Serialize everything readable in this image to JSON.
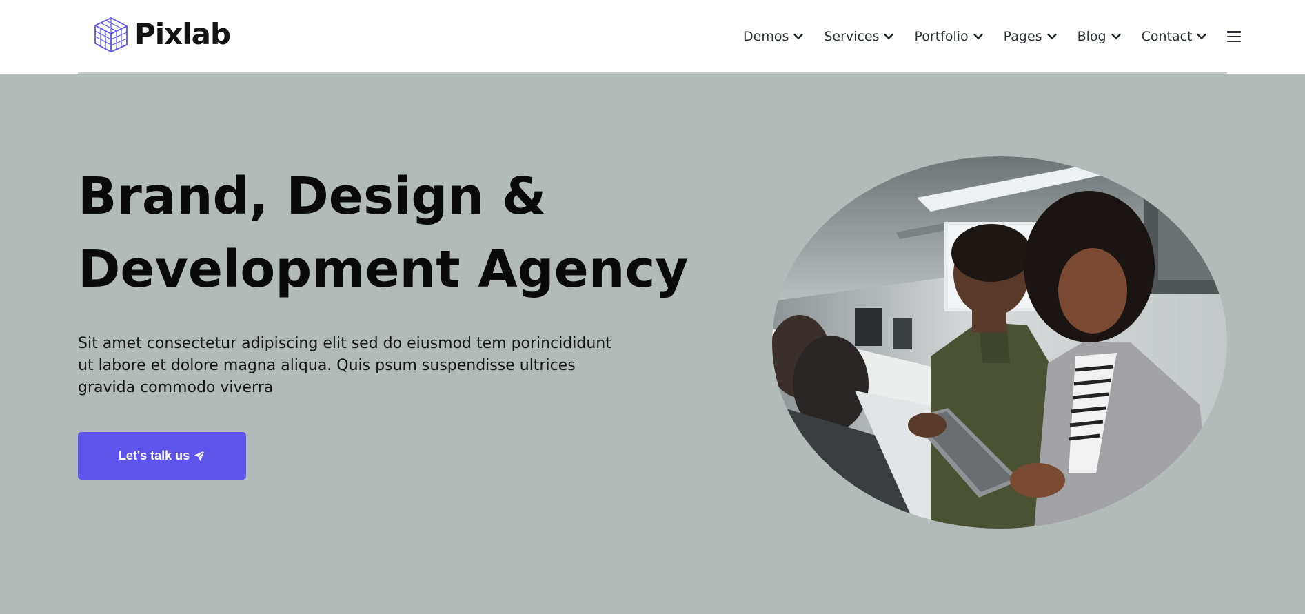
{
  "brand": {
    "name": "Pixlab",
    "logo_icon": "isometric-grid-cube-icon",
    "accent_color": "#5d54ec"
  },
  "nav": {
    "items": [
      {
        "label": "Demos",
        "icon": "chevron-down-icon"
      },
      {
        "label": "Services",
        "icon": "chevron-down-icon"
      },
      {
        "label": "Portfolio",
        "icon": "chevron-down-icon"
      },
      {
        "label": "Pages",
        "icon": "chevron-down-icon"
      },
      {
        "label": "Blog",
        "icon": "chevron-down-icon"
      },
      {
        "label": "Contact",
        "icon": "chevron-down-icon"
      }
    ],
    "menu_icon": "hamburger-menu-icon"
  },
  "hero": {
    "title_line1": "Brand, Design &",
    "title_line2": "Development Agency",
    "description": "Sit amet consectetur adipiscing elit sed do eiusmod tem porincididunt ut labore et dolore magna aliqua. Quis psum suspendisse ultrices gravida commodo viverra",
    "cta_label": "Let's talk us",
    "cta_icon": "paper-plane-icon",
    "image": "photo of two smiling colleagues looking at a tablet in an office"
  },
  "colors": {
    "page_background": "#b3bbb9",
    "header_background": "#ffffff",
    "heading": "#0a0a0a"
  }
}
